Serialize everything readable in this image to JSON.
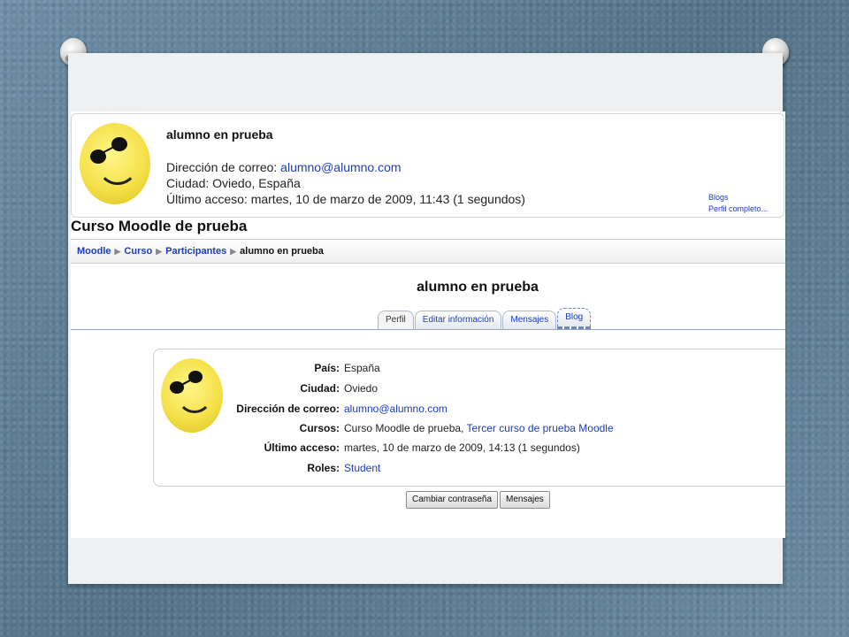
{
  "header": {
    "name": "alumno en prueba",
    "email_label": "Dirección de correo: ",
    "email": "alumno@alumno.com",
    "city_line": "Ciudad: Oviedo, España",
    "last_access_line": "Último acceso: martes, 10 de marzo de 2009, 11:43  (1 segundos)",
    "side_links": [
      "Blogs",
      "Perfil completo..."
    ]
  },
  "course_title": "Curso Moodle de prueba",
  "breadcrumb": {
    "items": [
      "Moodle",
      "Curso",
      "Participantes"
    ],
    "current": "alumno en prueba"
  },
  "page_heading": "alumno en prueba",
  "tabs": [
    "Perfil",
    "Editar información",
    "Mensajes",
    "Blog"
  ],
  "profile": {
    "pais_label": "País:",
    "pais": "España",
    "ciudad_label": "Ciudad:",
    "ciudad": "Oviedo",
    "email_label": "Dirección de correo:",
    "email": "alumno@alumno.com",
    "cursos_label": "Cursos:",
    "curso_1": "Curso Moodle de prueba",
    "curso_sep": ", ",
    "curso_2": "Tercer curso de prueba Moodle",
    "acceso_label": "Último acceso:",
    "acceso": "martes, 10 de marzo de 2009, 14:13  (1 segundos)",
    "roles_label": "Roles:",
    "roles": "Student"
  },
  "buttons": {
    "change_password": "Cambiar contraseña",
    "messages": "Mensajes"
  },
  "colors": {
    "link": "#1c3db7",
    "background": "#5f7f97",
    "slide": "#eef0f1"
  }
}
